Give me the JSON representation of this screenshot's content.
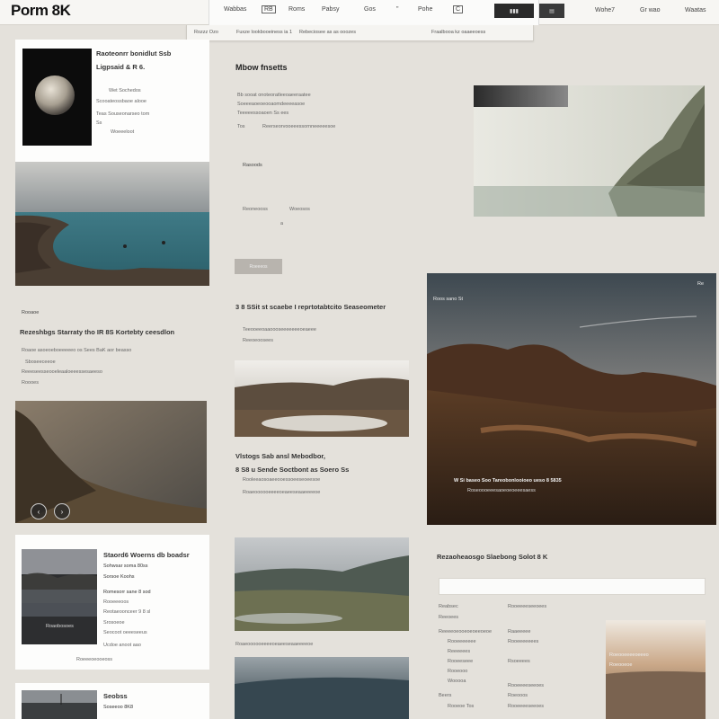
{
  "header": {
    "logo": "Porm 8K",
    "nav": [
      "Wabbas",
      "RB",
      "Roms",
      "Pabsy",
      "Gos",
      "\"",
      "Pohe"
    ],
    "nav_icon": "C",
    "right_links": [
      "Wohe7",
      "Gr wao",
      "Waatas"
    ]
  },
  "subbar": {
    "items": [
      "Rozzz    Ozo",
      "Fuxze lookbooeiness ia 1",
      "Rebeciosee as as ooozes",
      "Fraalbooa kz oaaeeoess"
    ]
  },
  "profile_card": {
    "title": "Raoteonrr bonidlut Ssb",
    "subtitle": "Ligpsaid &  R 6.",
    "lines": [
      "Wet Sochedos",
      "Scooateossbaoe alooe",
      "Teas Souseonarseo tom",
      "Ss"
    ],
    "link": "Woeeeloot"
  },
  "mid_top": {
    "heading": "Mbow fnsetts",
    "lines": [
      "Bb sooat onoteoratleeoaeeraatee",
      "Soeeeaoeoeooaomdeeeeasoe",
      "Teeeeessoaoen Ss ees"
    ],
    "sub": [
      "Tos",
      "Reerseorvooeeessornneeeeesoe"
    ],
    "label": "Rasoods",
    "stats": [
      "Reoneooss",
      "Woeosos",
      "a"
    ],
    "button": "Roeeeos"
  },
  "left_section": {
    "tag": "Rooaoe",
    "heading": "Rezeshbgs Starraty tho IR 8S Kortebty ceesdlon",
    "lines": [
      "Roaoe asoeoeboeeeeeo os Sees BaK aor beasso",
      "Sboseeceeoe",
      "Reeeseesseooeleaaloeeessesaeeso"
    ],
    "footer": "Roooes"
  },
  "mid_section": {
    "heading": "3 8 SSit st scaebe I reprtotabtcito Seaseometer",
    "lines": [
      "Teeooeeoaaoooseeeeeeeoeaeee",
      "Reeoeoosees"
    ]
  },
  "feature": {
    "tag": "Roos sano St",
    "tag_right": "Re",
    "caption": "W Si baseo Soo Tareobonlooioeo ueso 8 5835",
    "caption2": "Roseoooeeesaoeoeoeeesaess"
  },
  "mid_text": {
    "heading1": "Vlstogs Sab ansl Mebodbor,",
    "heading2": "8 S8 u Sende Soctbont as Soero Ss",
    "lines": [
      "Rooleeaosoaeeooessoeeseoeesoe",
      "Roaeoooooeeeeoeaeeseaaeeeeoe"
    ]
  },
  "bottom_left": {
    "title": "Staord6 Woerns db boadsr",
    "subtitle": "Sohwsar soma 80ss",
    "sub2": "Sorsoe Koohs",
    "tag": "Romesorr sane 8 sod",
    "lines": [
      "Rooeeeoos",
      "Reotaeoonceer 9 8 sl",
      "Srosoeoe",
      "Seocoot oeeeseeus",
      "Ucdoe anoot aao",
      "Soooed bs Boaae ekar"
    ],
    "img_caption": "Roaobosoes",
    "footer": "Roeeeoeooeoss"
  },
  "bottom_right": {
    "heading": "Rezaoheaosgo Slaebong Solot 8 K",
    "col1": [
      "Reabsec",
      "Reeoees",
      "Reeeeoeooeoeoeeoeoe",
      "Rooeeeeeee",
      "Reeeeees",
      "Rooeeseee",
      "Rooeooo",
      "Wooooa",
      "Rooeoe  Tos",
      "Beers"
    ],
    "col2": [
      "Rooeeeeseeoees",
      "Raaeeeee",
      "Rooeeeeeees",
      "Rsoeeees",
      "Rooeeeeseeoes",
      "Roeooos",
      "Rooeeeeseeoes"
    ],
    "img_lines": [
      "Roeooeeeeoeeeo",
      "Roeooeoe"
    ]
  },
  "bottom_tiny": {
    "title": "Seobss",
    "sub": "Soseeoo 8K8"
  },
  "colors": {
    "background": "#e4e1db",
    "card": "#fdfdfc",
    "accent_grey": "#b8b4ae"
  }
}
